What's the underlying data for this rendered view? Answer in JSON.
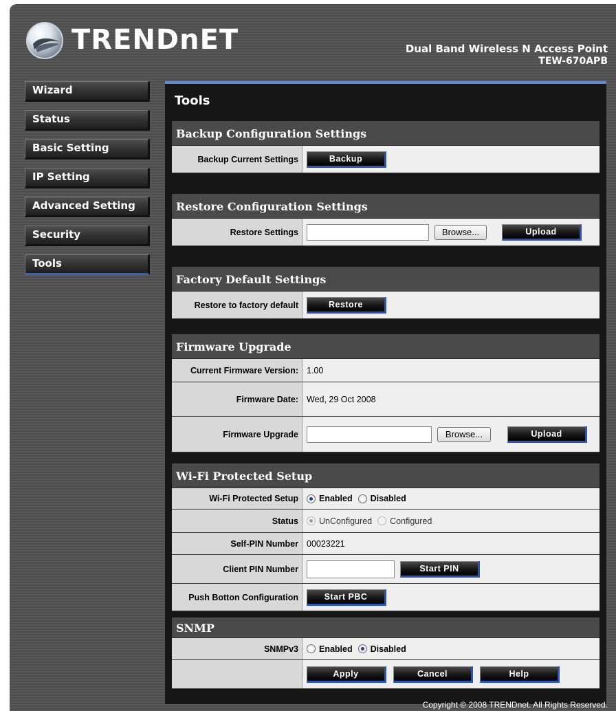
{
  "header": {
    "logo_text": "TRENDnET",
    "product_title": "Dual Band Wireless N Access Point",
    "product_model": "TEW-670APB"
  },
  "sidebar": {
    "items": [
      {
        "label": "Wizard"
      },
      {
        "label": "Status"
      },
      {
        "label": "Basic Setting"
      },
      {
        "label": "IP Setting"
      },
      {
        "label": "Advanced Setting"
      },
      {
        "label": "Security"
      },
      {
        "label": "Tools",
        "active": true
      }
    ]
  },
  "main": {
    "title": "Tools",
    "backup": {
      "heading": "Backup Configuration Settings",
      "row_label": "Backup Current Settings",
      "button": "Backup"
    },
    "restore": {
      "heading": "Restore Configuration Settings",
      "row_label": "Restore Settings",
      "browse": "Browse...",
      "upload": "Upload"
    },
    "factory": {
      "heading": "Factory Default Settings",
      "row_label": "Restore to factory default",
      "button": "Restore"
    },
    "firmware": {
      "heading": "Firmware Upgrade",
      "version_label": "Current Firmware Version:",
      "version_value": "1.00",
      "date_label": "Firmware Date:",
      "date_value": "Wed, 29 Oct 2008",
      "upgrade_label": "Firmware Upgrade",
      "browse": "Browse...",
      "upload": "Upload"
    },
    "wps": {
      "heading": "Wi-Fi Protected Setup",
      "wps_label": "Wi-Fi Protected Setup",
      "enabled": "Enabled",
      "disabled": "Disabled",
      "wps_selected": "Enabled",
      "status_label": "Status",
      "unconfigured": "UnConfigured",
      "configured": "Configured",
      "status_selected": "UnConfigured",
      "self_pin_label": "Self-PIN Number",
      "self_pin_value": "00023221",
      "client_pin_label": "Client PIN Number",
      "client_pin_value": "",
      "start_pin": "Start PIN",
      "pbc_label": "Push Botton Configuration",
      "start_pbc": "Start PBC"
    },
    "snmp": {
      "heading": "SNMP",
      "label": "SNMPv3",
      "enabled": "Enabled",
      "disabled": "Disabled",
      "selected": "Disabled"
    },
    "actions": {
      "apply": "Apply",
      "cancel": "Cancel",
      "help": "Help"
    }
  },
  "footer": {
    "copyright": "Copyright © 2008 TRENDnet. All Rights Reserved."
  },
  "colors": {
    "accent_blue": "#2f5fc8",
    "panel_dark": "#161616",
    "section_head": "#4a4a4a"
  }
}
